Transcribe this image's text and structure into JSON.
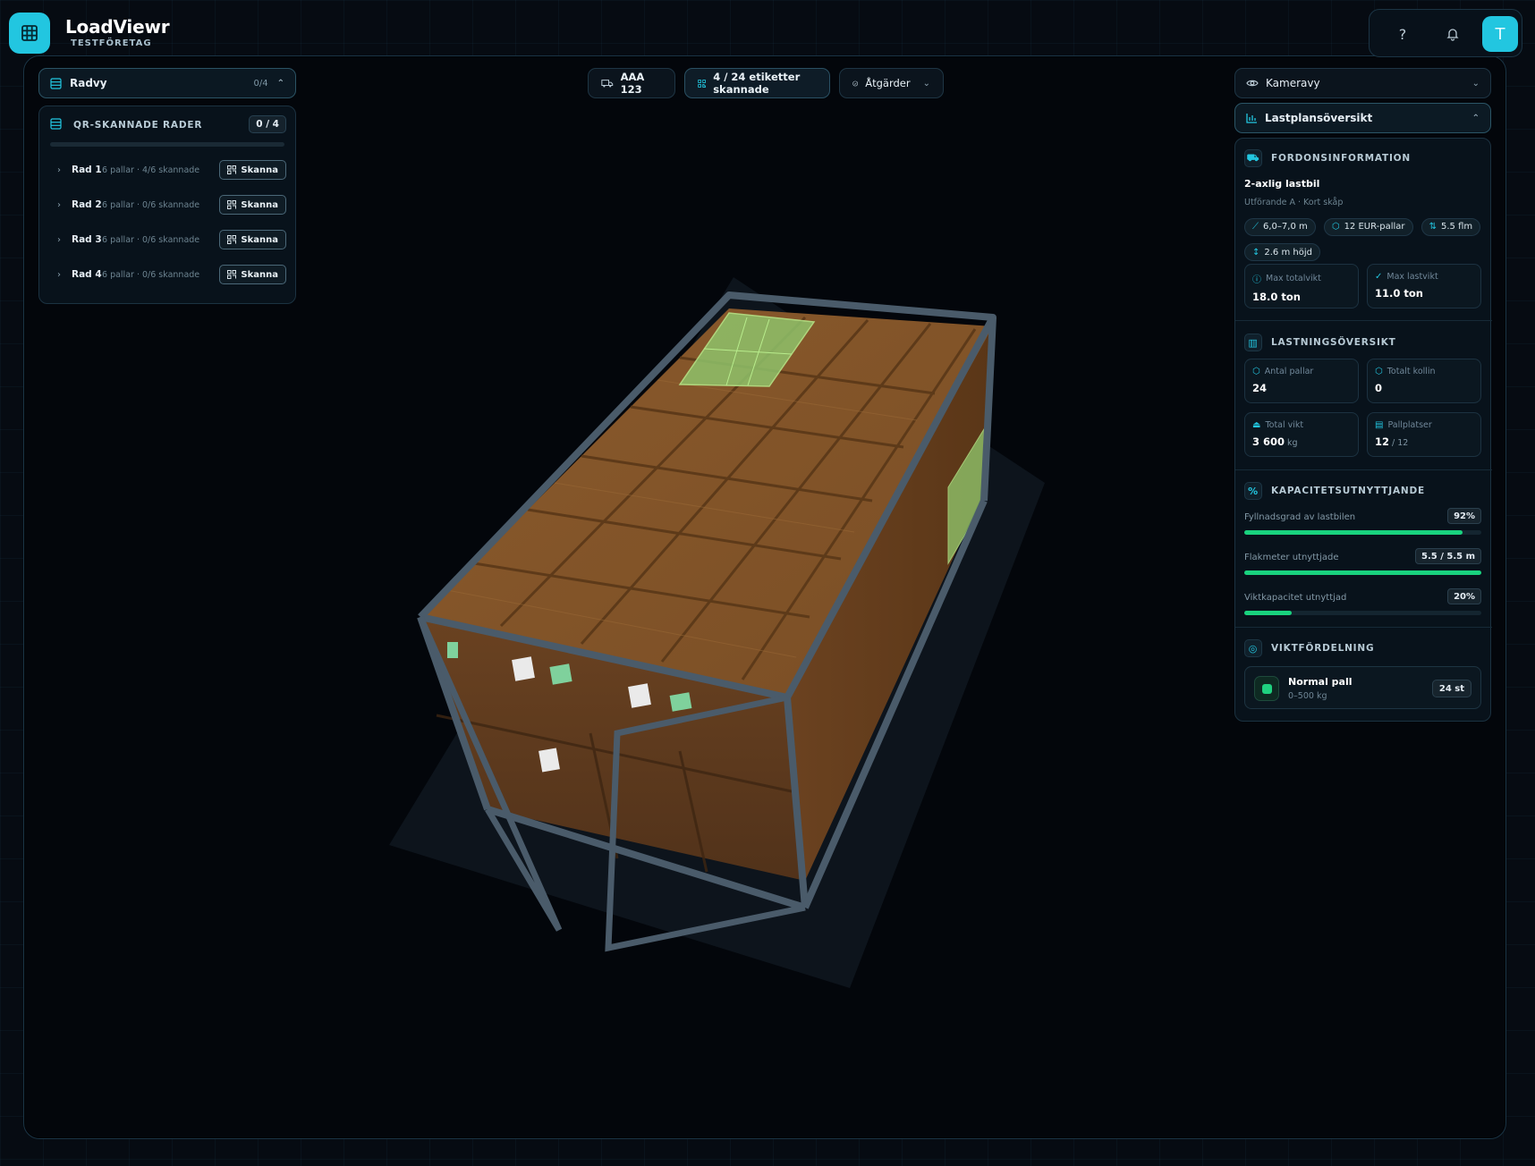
{
  "app": {
    "title": "LoadViewr",
    "company": "TESTFÖRETAG",
    "help": "?",
    "avatar_initial": "T"
  },
  "toolbar": {
    "vehicle": "AAA 123",
    "labels_scanned": "4 / 24 etiketter skannade",
    "actions": "Åtgärder"
  },
  "row_panel": {
    "header_label": "Radvy",
    "header_count": "0/4",
    "card_title": "QR-SKANNADE RADER",
    "card_badge": "0 / 4",
    "progress_fraction": 0,
    "rows": [
      {
        "name": "Rad 1",
        "meta": "6 pallar · 4/6 skannade",
        "button": "Skanna"
      },
      {
        "name": "Rad 2",
        "meta": "6 pallar · 0/6 skannade",
        "button": "Skanna"
      },
      {
        "name": "Rad 3",
        "meta": "6 pallar · 0/6 skannade",
        "button": "Skanna"
      },
      {
        "name": "Rad 4",
        "meta": "6 pallar · 0/6 skannade",
        "button": "Skanna"
      }
    ]
  },
  "right_panel": {
    "camera_label": "Kameravy",
    "plan_label": "Lastplansöversikt",
    "vehicle_info": {
      "heading": "FORDONSINFORMATION",
      "name": "2-axlig lastbil",
      "variant": "Utförande A · Kort skåp",
      "chips": [
        "6,0–7,0 m",
        "12 EUR-pallar",
        "5.5 flm",
        "2.6 m höjd"
      ],
      "max_total_label": "Max totalvikt",
      "max_total_value": "18.0 ton",
      "max_load_label": "Max lastvikt",
      "max_load_value": "11.0 ton"
    },
    "loading_overview": {
      "heading": "LASTNINGSÖVERSIKT",
      "pallets_label": "Antal pallar",
      "pallets_value": "24",
      "colli_label": "Totalt kollin",
      "colli_value": "0",
      "weight_label": "Total vikt",
      "weight_value": "3 600",
      "weight_unit": "kg",
      "slots_label": "Pallplatser",
      "slots_value": "12",
      "slots_unit": "/ 12"
    },
    "capacity": {
      "heading": "KAPACITETSUTNYTTJANDE",
      "items": [
        {
          "label": "Fyllnadsgrad av lastbilen",
          "value": "92%",
          "fraction": 0.92
        },
        {
          "label": "Flakmeter utnyttjade",
          "value": "5.5 / 5.5 m",
          "fraction": 1.0
        },
        {
          "label": "Viktkapacitet utnyttjad",
          "value": "20%",
          "fraction": 0.2
        }
      ]
    },
    "weight_distribution": {
      "heading": "VIKTFÖRDELNING",
      "item_name": "Normal pall",
      "item_range": "0–500 kg",
      "item_count": "24 st"
    }
  },
  "colors": {
    "accent": "#22c6e0",
    "progress": "#19d27e",
    "pallet": "#8a5a2b",
    "scanned": "#8fc26a",
    "frame": "#4a5b6a"
  }
}
